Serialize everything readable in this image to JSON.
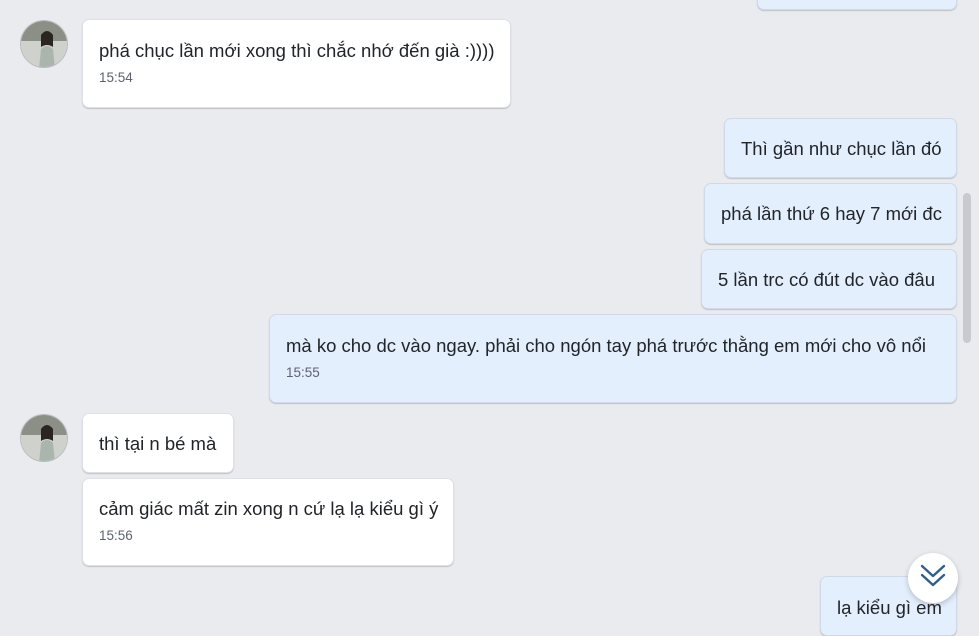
{
  "contact": {
    "avatar_icon": "contact-avatar-icon"
  },
  "messages": [
    {
      "id": "m0",
      "direction": "out",
      "text": "",
      "time": ""
    },
    {
      "id": "m1",
      "direction": "in",
      "text": "phá chục lần mới xong thì chắc nhớ đến già :))))",
      "time": "15:54"
    },
    {
      "id": "m2",
      "direction": "out",
      "text": "Thì gần như chục lần đó",
      "time": ""
    },
    {
      "id": "m3",
      "direction": "out",
      "text": "phá lần thứ 6 hay 7 mới đc",
      "time": ""
    },
    {
      "id": "m4",
      "direction": "out",
      "text": "5 lần trc có đút dc vào đâu",
      "time": ""
    },
    {
      "id": "m5",
      "direction": "out",
      "text": "mà ko cho dc vào ngay. phải cho ngón tay phá trước thằng em mới cho vô nổi",
      "time": "15:55"
    },
    {
      "id": "m6",
      "direction": "in",
      "text": "thì tại n bé mà",
      "time": ""
    },
    {
      "id": "m7",
      "direction": "in",
      "text": "cảm giác mất zin xong n cứ lạ lạ kiểu gì ý",
      "time": "15:56"
    },
    {
      "id": "m8",
      "direction": "out",
      "text": "lạ kiểu gì em",
      "time": ""
    }
  ],
  "scroll_to_bottom": {
    "icon": "double-chevron-down-icon"
  },
  "colors": {
    "background": "#eaebef",
    "incoming": "#ffffff",
    "outgoing": "#e4effe"
  }
}
